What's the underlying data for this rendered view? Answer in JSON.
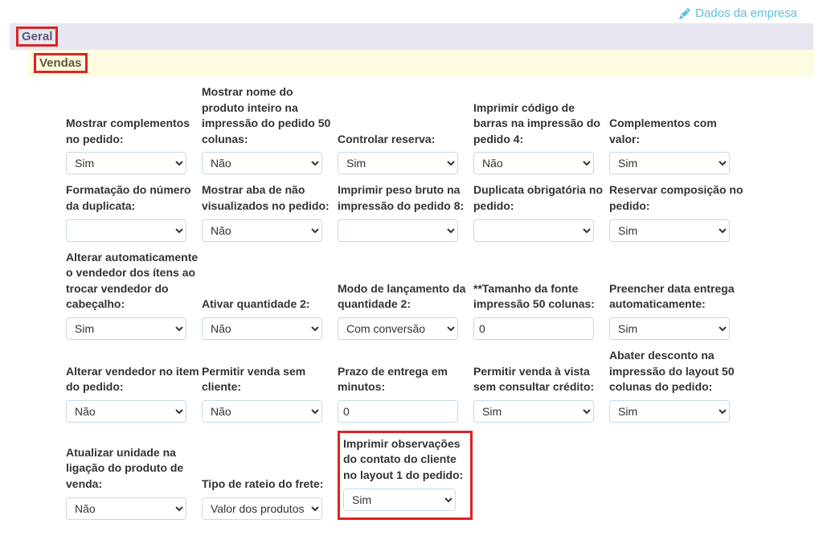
{
  "top_link": "Dados da empresa",
  "tabs": {
    "geral": "Geral",
    "vendas": "Vendas"
  },
  "options": {
    "sim": "Sim",
    "nao": "Não",
    "empty": "",
    "com_conv": "Com conversão",
    "valor_prod": "Valor dos produtos",
    "zero": "0"
  },
  "fields": {
    "r1c1": {
      "label": "Mostrar complementos no pedido:",
      "value": "sim"
    },
    "r1c2": {
      "label": "Mostrar nome do produto inteiro na impressão do pedido 50 colunas:",
      "value": "nao"
    },
    "r1c3": {
      "label": "Controlar reserva:",
      "value": "sim"
    },
    "r1c4": {
      "label": "Imprimir código de barras na impressão do pedido 4:",
      "value": "nao"
    },
    "r1c5": {
      "label": "Complementos com valor:",
      "value": "sim"
    },
    "r2c1": {
      "label": "Formatação do número da duplicata:",
      "value": "empty"
    },
    "r2c2": {
      "label": "Mostrar aba de não visualizados no pedido:",
      "value": "nao"
    },
    "r2c3": {
      "label": "Imprimir peso bruto na impressão do pedido 8:",
      "value": "empty"
    },
    "r2c4": {
      "label": "Duplicata obrigatória no pedido:",
      "value": "empty"
    },
    "r2c5": {
      "label": "Reservar composição no pedido:",
      "value": "sim"
    },
    "r3c1": {
      "label": "Alterar automaticamente o vendedor dos ítens ao trocar vendedor do cabeçalho:",
      "value": "sim"
    },
    "r3c2": {
      "label": "Ativar quantidade 2:",
      "value": "nao"
    },
    "r3c3": {
      "label": "Modo de lançamento da quantidade 2:",
      "value": "com_conv"
    },
    "r3c4": {
      "label": "**Tamanho da fonte impressão 50 colunas:",
      "value": "zero",
      "type": "text"
    },
    "r3c5": {
      "label": "Preencher data entrega automaticamente:",
      "value": "sim"
    },
    "r4c1": {
      "label": "Alterar vendedor no item do pedido:",
      "value": "nao"
    },
    "r4c2": {
      "label": "Permitir venda sem cliente:",
      "value": "nao"
    },
    "r4c3": {
      "label": "Prazo de entrega em minutos:",
      "value": "zero",
      "type": "text"
    },
    "r4c4": {
      "label": "Permitir venda à vista sem consultar crédito:",
      "value": "sim"
    },
    "r4c5": {
      "label": "Abater desconto na impressão do layout 50 colunas do pedido:",
      "value": "sim"
    },
    "r5c1": {
      "label": "Atualizar unidade na ligação do produto de venda:",
      "value": "nao"
    },
    "r5c2": {
      "label": "Tipo de rateio do frete:",
      "value": "valor_prod"
    },
    "r5c3": {
      "label": "Imprimir observações do contato do cliente no layout 1 do pedido:",
      "value": "sim",
      "highlight": true
    }
  }
}
